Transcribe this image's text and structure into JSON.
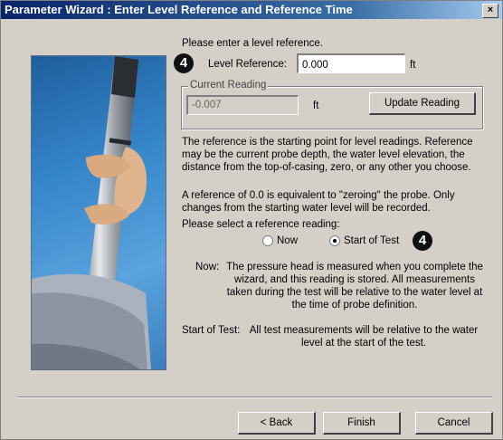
{
  "window": {
    "title": "Parameter Wizard : Enter Level Reference and Reference Time",
    "close_label": "×"
  },
  "form": {
    "prompt": "Please enter a level reference.",
    "level_reference_label": "Level Reference:",
    "level_reference_value": "0.000",
    "unit": "ft",
    "current_reading": {
      "group_title": "Current Reading",
      "value": "-0.007",
      "unit": "ft",
      "update_button": "Update Reading"
    }
  },
  "explanation": {
    "p1": "The reference is the starting point for level readings. Reference may be the current probe depth, the water level elevation, the distance from the top-of-casing, zero, or any other you choose.",
    "p2": "A reference of 0.0 is equivalent to \"zeroing\" the probe.  Only changes from the starting water level will be recorded."
  },
  "reference_reading": {
    "prompt": "Please select a reference reading:",
    "options": [
      {
        "label": "Now",
        "selected": false
      },
      {
        "label": "Start of Test",
        "selected": true
      }
    ],
    "now_term": "Now:",
    "now_desc": "The pressure head is measured when you complete the wizard, and this reading is stored.  All measurements taken during the test will be relative to the water level at the time of probe definition.",
    "start_term": "Start of Test:",
    "start_desc": "All test measurements will be relative to the water level at the start of the test."
  },
  "badges": {
    "first": "4",
    "second": "4"
  },
  "buttons": {
    "back": "< Back",
    "finish": "Finish",
    "cancel": "Cancel"
  },
  "colors": {
    "title_bar": "#0a246a",
    "dialog_bg": "#d4d0c8",
    "illustration_bg": "#3585c9"
  }
}
